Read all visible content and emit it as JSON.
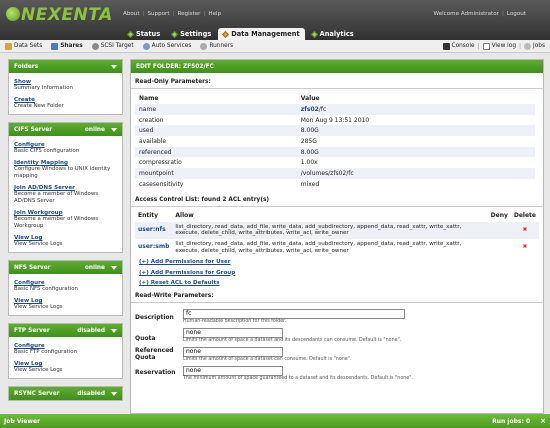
{
  "brand": {
    "logo_text": "NEXENTA",
    "logo_color": "#8cc43c"
  },
  "top_links": [
    "About",
    "Support",
    "Register",
    "Help"
  ],
  "user_links": [
    "Welcome Administrator",
    "Logout"
  ],
  "tabs": [
    {
      "label": "Status",
      "active": false
    },
    {
      "label": "Settings",
      "active": false
    },
    {
      "label": "Data Management",
      "active": true
    },
    {
      "label": "Analytics",
      "active": false
    }
  ],
  "subnav": {
    "left": [
      {
        "label": "Data Sets",
        "icon": "datasets-icon"
      },
      {
        "label": "Shares",
        "icon": "shares-icon"
      },
      {
        "label": "SCSI Target",
        "icon": "scsi-icon"
      },
      {
        "label": "Auto Services",
        "icon": "auto-services-icon"
      },
      {
        "label": "Runners",
        "icon": "runners-icon"
      }
    ],
    "right": [
      {
        "label": "Console",
        "icon": "console-icon"
      },
      {
        "label": "View log",
        "icon": "view-log-icon"
      },
      {
        "label": "Jobs",
        "icon": "jobs-icon"
      }
    ]
  },
  "sidebar": {
    "folders": {
      "title": "Folders",
      "items": [
        {
          "link": "Show",
          "desc": "Summary Information"
        },
        {
          "link": "Create",
          "desc": "Create New Folder"
        }
      ]
    },
    "cifs": {
      "title": "CIFS Server",
      "status": "online",
      "items": [
        {
          "link": "Configure",
          "desc": "Basic CIFS configuration"
        },
        {
          "link": "Identity Mapping",
          "desc": "Configure Windows to UNIX identity mapping"
        },
        {
          "link": "Join AD/DNS Server",
          "desc": "Become a member of Windows AD/DNS Server"
        },
        {
          "link": "Join Workgroup",
          "desc": "Become a member of Windows Workgroup"
        },
        {
          "link": "View Log",
          "desc": "View Service Logs"
        }
      ]
    },
    "nfs": {
      "title": "NFS Server",
      "status": "online",
      "items": [
        {
          "link": "Configure",
          "desc": "Basic NFS configuration"
        },
        {
          "link": "View Log",
          "desc": "View Service Logs"
        }
      ]
    },
    "ftp": {
      "title": "FTP Server",
      "status": "disabled",
      "items": [
        {
          "link": "Configure",
          "desc": "Basic FTP configuration"
        },
        {
          "link": "View Log",
          "desc": "View Service Logs"
        }
      ]
    },
    "rsync": {
      "title": "RSYNC Server",
      "status": "disabled"
    }
  },
  "main": {
    "title": "EDIT FOLDER: ZFS02/FC",
    "readonly_heading": "Read-Only Parameters:",
    "ro_columns": [
      "Name",
      "Value"
    ],
    "ro_rows": [
      {
        "name": "name",
        "value_bold": "zfs02",
        "value_rest": "/fc"
      },
      {
        "name": "creation",
        "value_bold": "",
        "value_rest": "Mon Aug 9 13:51 2010"
      },
      {
        "name": "used",
        "value_bold": "",
        "value_rest": "8.00G"
      },
      {
        "name": "available",
        "value_bold": "",
        "value_rest": "285G"
      },
      {
        "name": "referenced",
        "value_bold": "",
        "value_rest": "8.00G"
      },
      {
        "name": "compressratio",
        "value_bold": "",
        "value_rest": "1.00x"
      },
      {
        "name": "mountpoint",
        "value_bold": "",
        "value_rest": "/volumes/zfs02/fc"
      },
      {
        "name": "casesensitivity",
        "value_bold": "",
        "value_rest": "mixed"
      }
    ],
    "acl_heading": "Access Control List: found 2 ACL entry(s)",
    "acl_columns": [
      "Entity",
      "Allow",
      "Deny",
      "Delete"
    ],
    "acl_rows": [
      {
        "entity": "user:nfs",
        "allow": "list_directory, read_data, add_file, write_data, add_subdirectory, append_data, read_xattr, write_xattr, execute, delete_child, write_attributes, write_acl, write_owner",
        "deny": ""
      },
      {
        "entity": "user:smb",
        "allow": "list_directory, read_data, add_file, write_data, add_subdirectory, append_data, read_xattr, write_xattr, execute, delete_child, write_attributes, write_acl, write_owner",
        "deny": ""
      }
    ],
    "acl_links": [
      "(+) Add Permissions for User",
      "(+) Add Permissions for Group",
      "(+) Reset ACL to Defaults"
    ],
    "rw_heading": "Read-Write Parameters:",
    "rw_fields": [
      {
        "label": "Description",
        "value": "fc",
        "hint": "Human-readable description for this folder."
      },
      {
        "label": "Quota",
        "value": "none",
        "hint": "Limits the amount of space a dataset and its descendants can consume. Default is \"none\"."
      },
      {
        "label": "Referenced Quota",
        "value": "none",
        "hint": "Limits the amount of space a dataset can consume. Default is \"none\"."
      },
      {
        "label": "Reservation",
        "value": "none",
        "hint": "The minimum amount of space guaranteed to a dataset and its descendants. Default is \"none\"."
      }
    ]
  },
  "job_viewer": {
    "title": "Job Viewer",
    "run_jobs": "Run jobs: 0",
    "close": "×"
  }
}
